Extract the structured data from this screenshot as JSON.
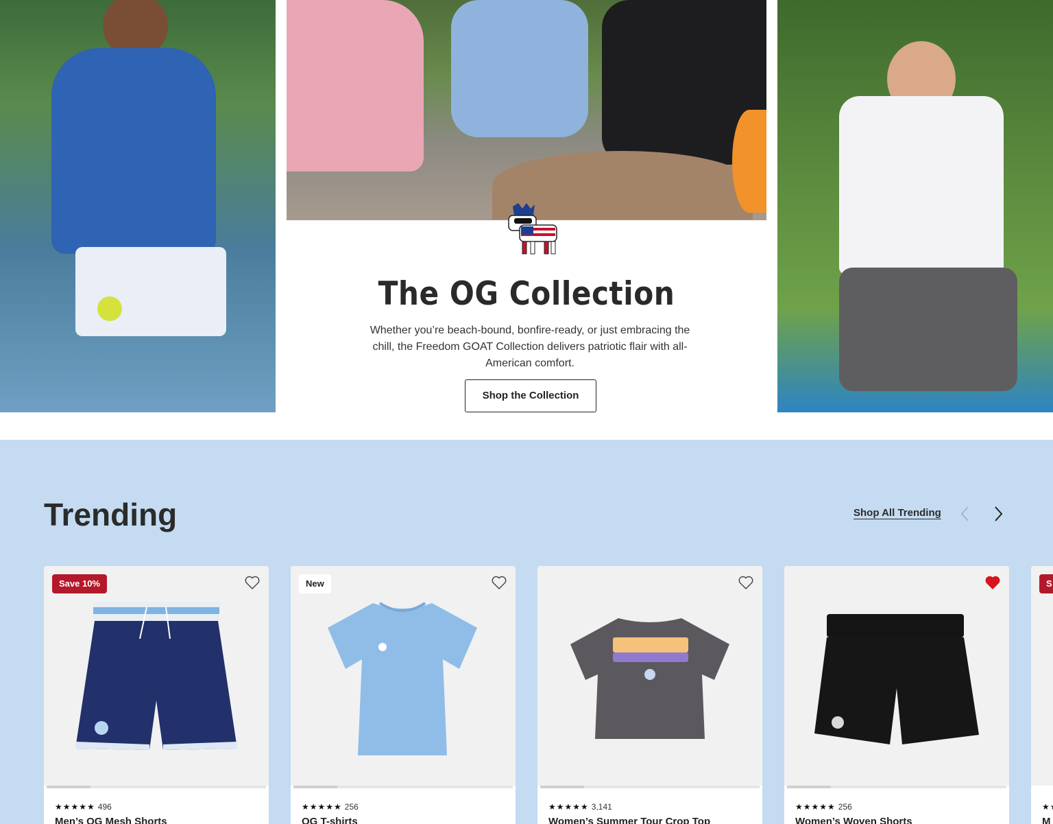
{
  "hero": {
    "title": "The OG Collection",
    "description": "Whether you’re beach-bound, bonfire-ready, or just embracing the chill, the Freedom GOAT Collection delivers patriotic flair with all-American comfort.",
    "cta_label": "Shop the Collection"
  },
  "trending": {
    "title": "Trending",
    "shop_all_label": "Shop All Trending",
    "products": [
      {
        "badge": "Save 10%",
        "rating_count": "496",
        "name": "Men’s OG Mesh Shorts",
        "favorited": false
      },
      {
        "badge": "New",
        "rating_count": "256",
        "name": "OG T-shirts",
        "favorited": false
      },
      {
        "badge": "",
        "rating_count": "3,141",
        "name": "Women’s Summer Tour Crop Top",
        "favorited": false
      },
      {
        "badge": "",
        "rating_count": "256",
        "name": "Women’s Woven Shorts",
        "favorited": true
      },
      {
        "badge": "S",
        "rating_count": "",
        "name": "M",
        "favorited": false
      }
    ],
    "stars": "★★★★★"
  },
  "colors": {
    "trending_bg": "#c4dbf1",
    "badge_sale": "#b3192b",
    "heart_active": "#d7141c"
  }
}
